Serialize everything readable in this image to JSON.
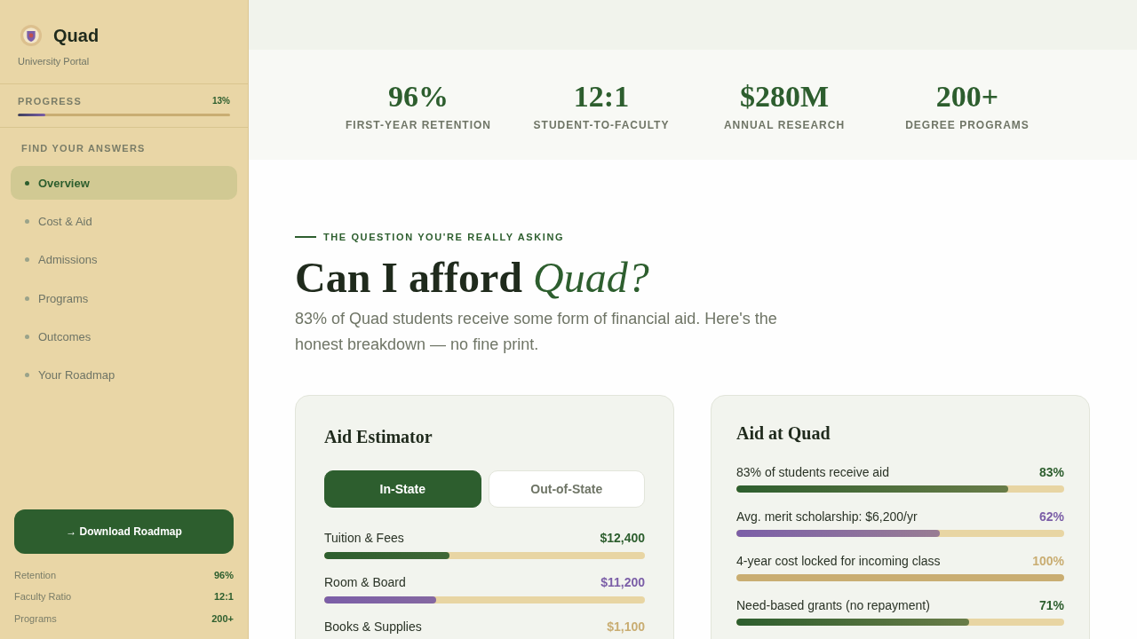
{
  "sidebar": {
    "brand": {
      "name": "Quad",
      "subtitle": "University Portal"
    },
    "progress": {
      "label": "PROGRESS",
      "reading": "13%",
      "level": 0.13
    },
    "nav_heading": "FIND YOUR ANSWERS",
    "nav_items": [
      {
        "label": "Overview",
        "selected": true
      },
      {
        "label": "Cost & Aid",
        "selected": false
      },
      {
        "label": "Admissions",
        "selected": false
      },
      {
        "label": "Programs",
        "selected": false
      },
      {
        "label": "Outcomes",
        "selected": false
      },
      {
        "label": "Your Roadmap",
        "selected": false
      }
    ],
    "download_button": "→ Download Roadmap",
    "quick_stats": [
      {
        "label": "Retention",
        "value": "96%"
      },
      {
        "label": "Faculty Ratio",
        "value": "12:1"
      },
      {
        "label": "Programs",
        "value": "200+"
      }
    ]
  },
  "stats": [
    {
      "value": "96%",
      "label": "FIRST-YEAR RETENTION"
    },
    {
      "value": "12:1",
      "label": "STUDENT-TO-FACULTY"
    },
    {
      "value": "$280M",
      "label": "ANNUAL RESEARCH"
    },
    {
      "value": "200+",
      "label": "DEGREE PROGRAMS"
    }
  ],
  "hero": {
    "eyebrow": "THE QUESTION YOU'RE REALLY ASKING",
    "title": "Can I afford *Quad?*",
    "lead": "83% of Quad students receive some form of financial aid. Here's the honest breakdown — no fine print."
  },
  "aid_estimator": {
    "title": "Aid Estimator",
    "options": [
      {
        "label": "In-State",
        "selected": true
      },
      {
        "label": "Out-of-State",
        "selected": false
      }
    ],
    "rows": [
      {
        "label": "Tuition & Fees",
        "value": "$12,400",
        "color": "#2d5e2e",
        "level": 0.39
      },
      {
        "label": "Room & Board",
        "value": "$11,200",
        "color": "#7b5ea7",
        "level": 0.35
      },
      {
        "label": "Books & Supplies",
        "value": "$1,100",
        "color": "#c9ad72"
      }
    ]
  },
  "aid_at_quad": {
    "title": "Aid at Quad",
    "rows": [
      {
        "label": "83% of students receive aid",
        "value": "83%",
        "color": "#2d5e2e",
        "level": 0.83
      },
      {
        "label": "Avg. merit scholarship: $6,200/yr",
        "value": "62%",
        "color": "#7b5ea7",
        "level": 0.62
      },
      {
        "label": "4-year cost locked for incoming class",
        "value": "100%",
        "color": "#c9ad72",
        "level": 1
      },
      {
        "label": "Need-based grants (no repayment)",
        "value": "71%",
        "color": "#2d5e2e",
        "level": 0.71
      }
    ]
  }
}
